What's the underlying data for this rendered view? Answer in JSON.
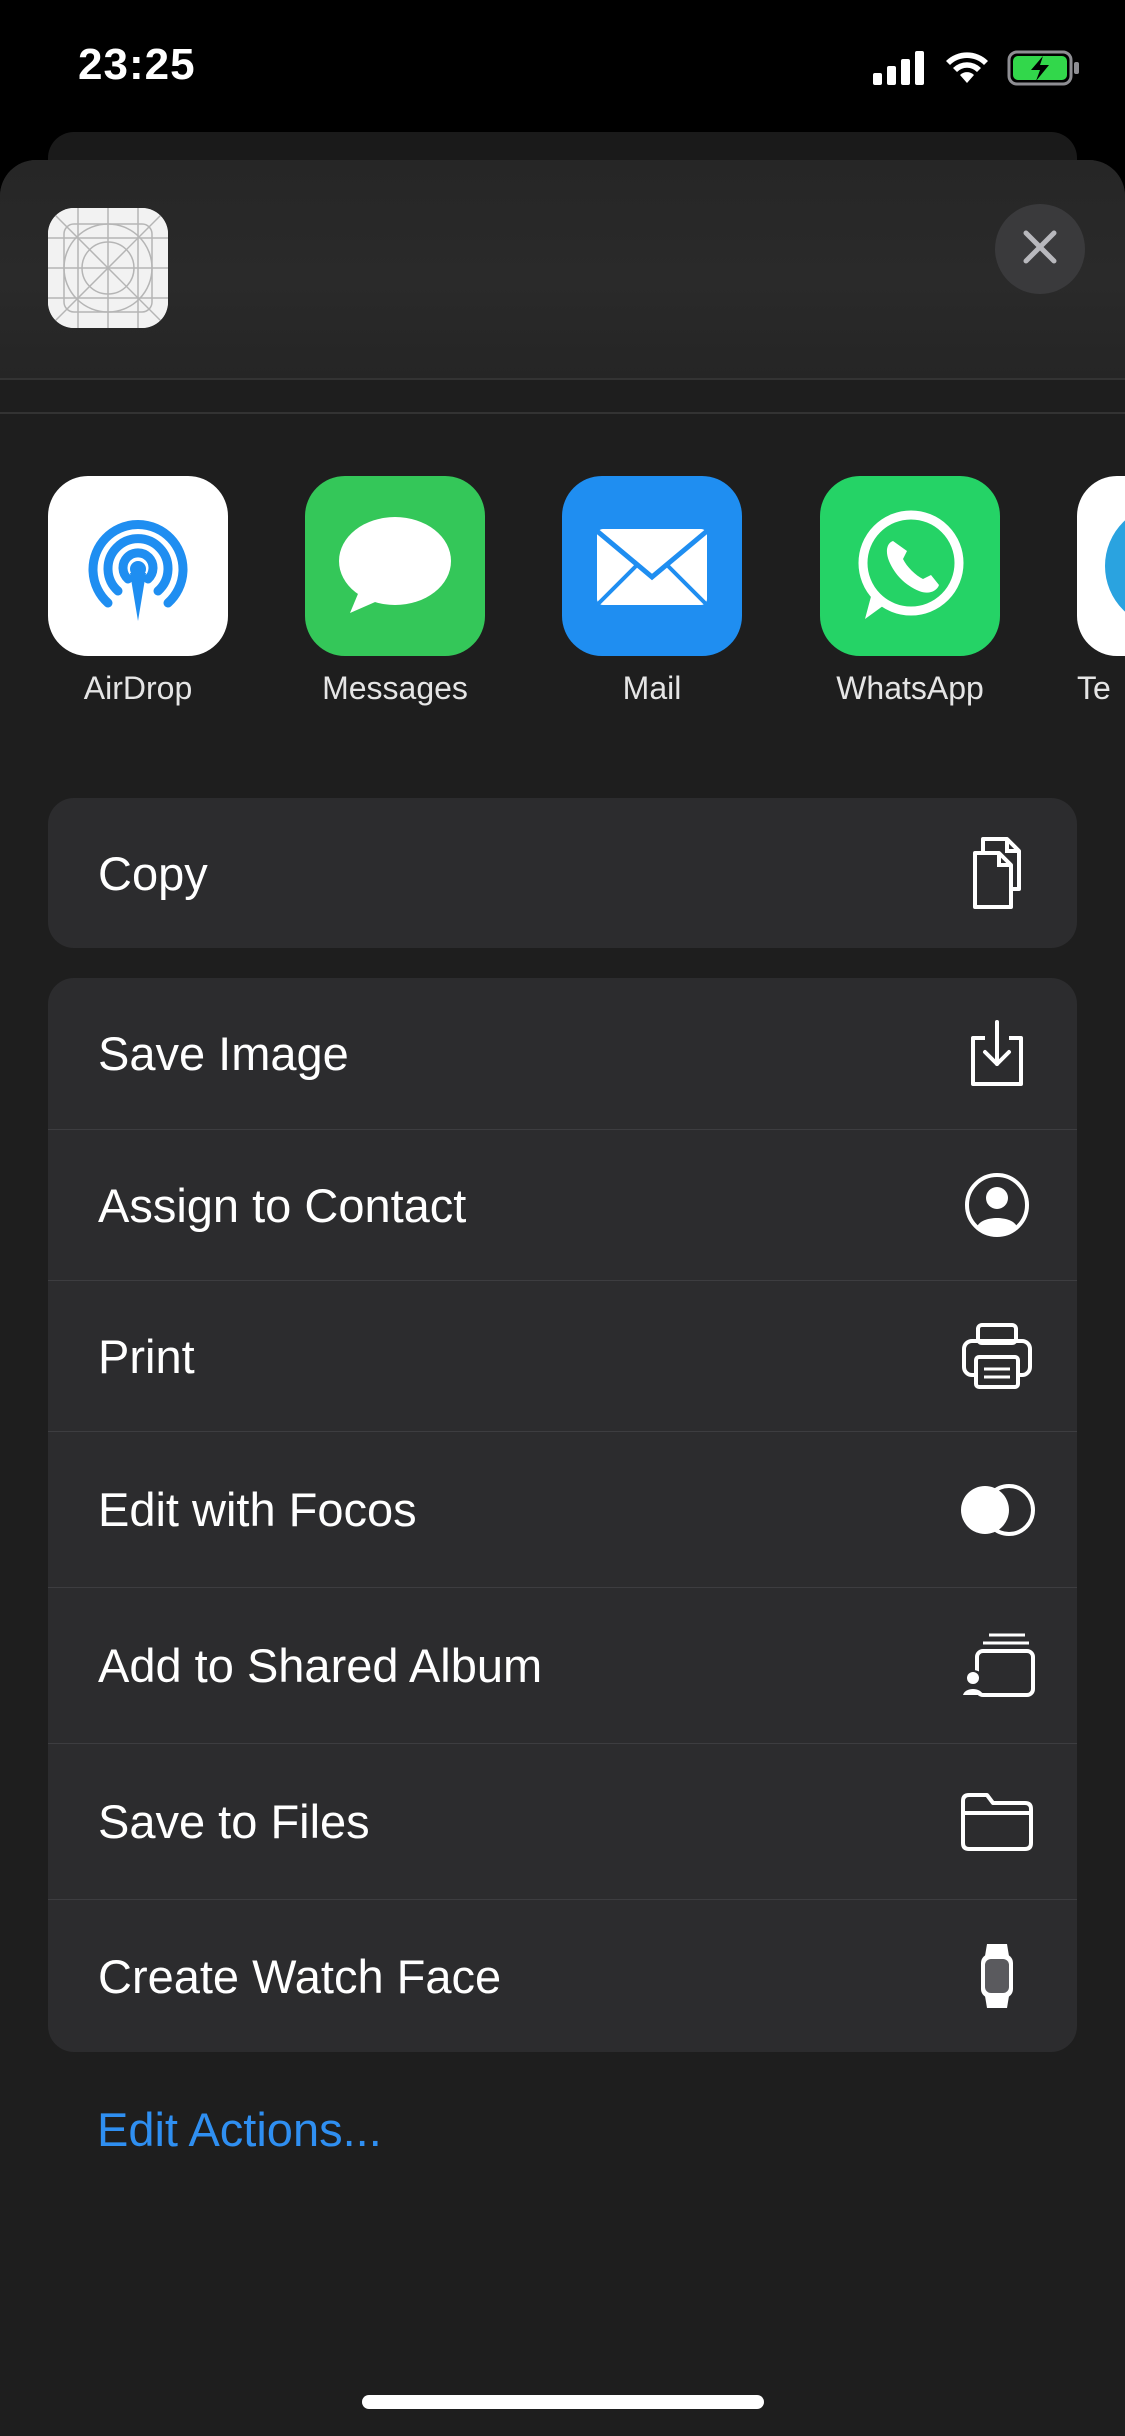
{
  "status_bar": {
    "time": "23:25",
    "icons": [
      "cellular-signal-icon",
      "wifi-icon",
      "battery-charging-icon"
    ]
  },
  "header": {
    "thumbnail_icon": "app-icon-template-thumbnail",
    "close_icon": "close-icon"
  },
  "apps": [
    {
      "label": "AirDrop",
      "icon": "airdrop-icon",
      "color": "#ffffff"
    },
    {
      "label": "Messages",
      "icon": "messages-icon",
      "color": "#34c759"
    },
    {
      "label": "Mail",
      "icon": "mail-icon",
      "color": "#1f8ef1"
    },
    {
      "label": "WhatsApp",
      "icon": "whatsapp-icon",
      "color": "#25d366"
    },
    {
      "label": "Te",
      "icon": "telegram-icon",
      "color": "#ffffff"
    }
  ],
  "actions": {
    "copy": {
      "label": "Copy",
      "icon": "copy-icon"
    },
    "save_image": {
      "label": "Save Image",
      "icon": "save-image-icon"
    },
    "assign_contact": {
      "label": "Assign to Contact",
      "icon": "contact-icon"
    },
    "print": {
      "label": "Print",
      "icon": "printer-icon"
    },
    "edit_focos": {
      "label": "Edit with Focos",
      "icon": "focos-icon"
    },
    "shared_album": {
      "label": "Add to Shared Album",
      "icon": "shared-album-icon"
    },
    "save_files": {
      "label": "Save to Files",
      "icon": "folder-icon"
    },
    "watch_face": {
      "label": "Create Watch Face",
      "icon": "watch-icon"
    }
  },
  "edit_actions": "Edit Actions...",
  "colors": {
    "sheet_bg": "#1e1e1e",
    "group_bg": "#2c2c2e",
    "accent_link": "#2f8ff1"
  }
}
